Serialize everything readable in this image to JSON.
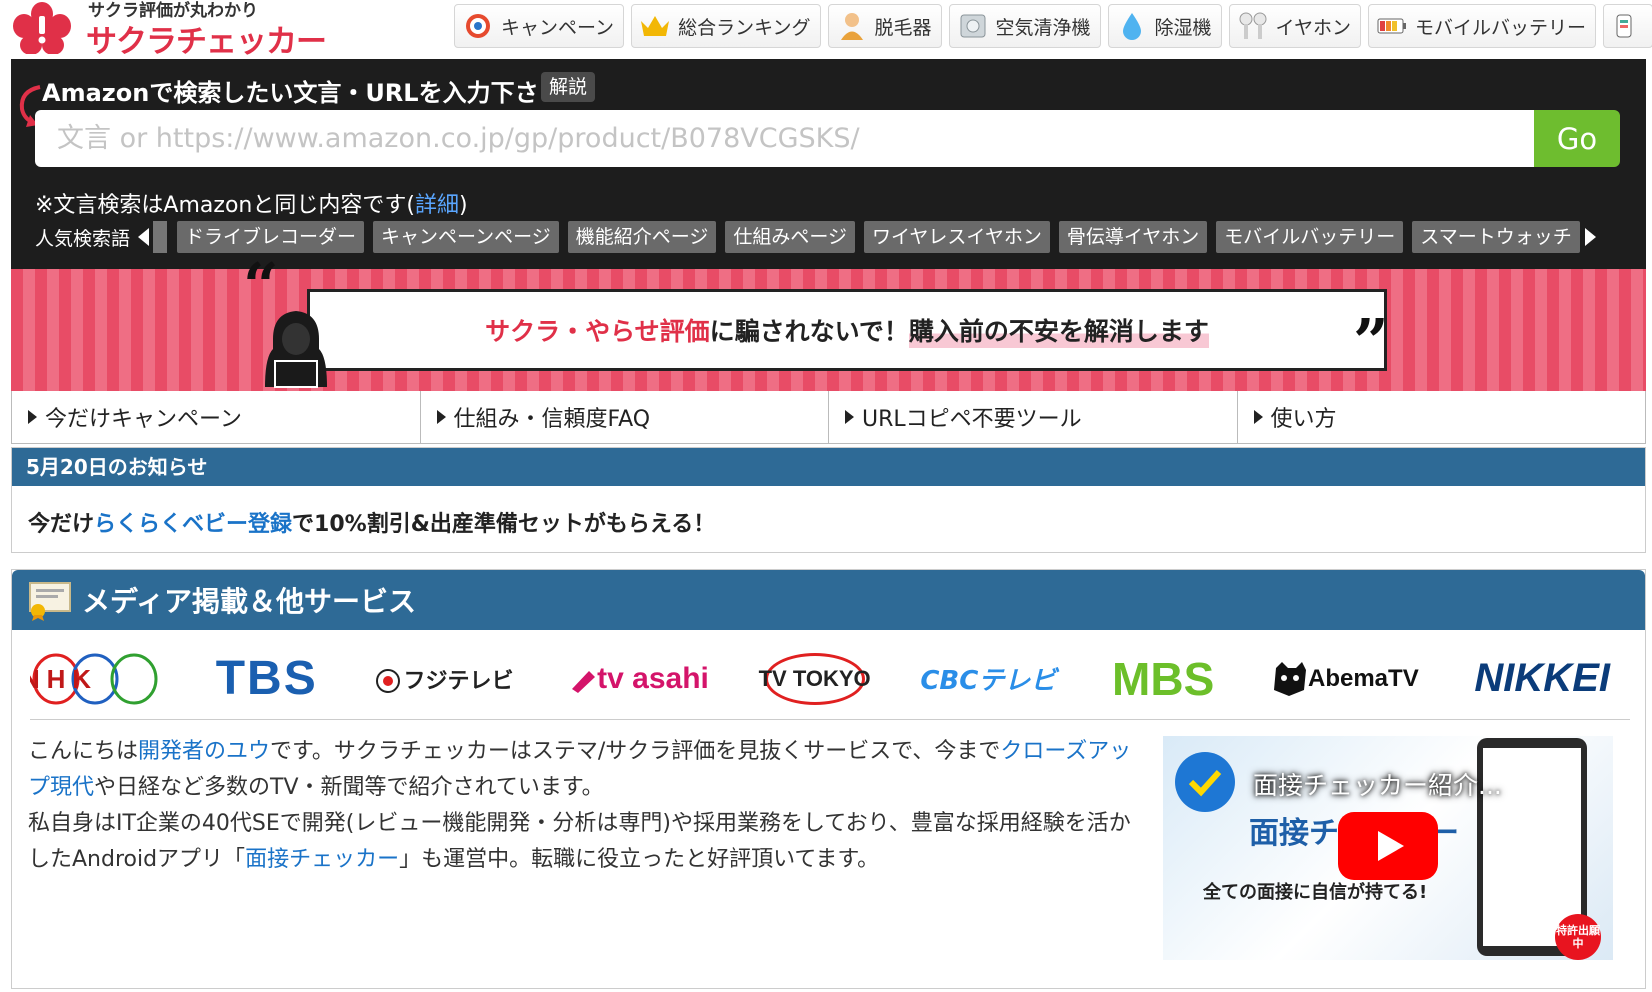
{
  "header": {
    "tagline": "サクラ評価が丸わかり",
    "site_name": "サクラチェッカー",
    "nav": [
      {
        "label": "キャンペーン",
        "icon": "target-icon"
      },
      {
        "label": "総合ランキング",
        "icon": "crown-icon"
      },
      {
        "label": "脱毛器",
        "icon": "person-icon"
      },
      {
        "label": "空気清浄機",
        "icon": "air-purifier-icon"
      },
      {
        "label": "除湿機",
        "icon": "water-drop-icon"
      },
      {
        "label": "イヤホン",
        "icon": "earphones-icon"
      },
      {
        "label": "モバイルバッテリー",
        "icon": "battery-icon"
      }
    ]
  },
  "search": {
    "title": "Amazonで検索したい文言・URLを入力下さい",
    "help_badge": "解説",
    "placeholder": "文言 or https://www.amazon.co.jp/gp/product/B078VCGSKS/",
    "go_label": "Go",
    "note_prefix": "※文言検索はAmazonと同じ内容です(",
    "note_link": "詳細",
    "note_suffix": ")",
    "popular_label": "人気検索語",
    "popular_tags": [
      "ドライブレコーダー",
      "キャンペーンページ",
      "機能紹介ページ",
      "仕組みページ",
      "ワイヤレスイヤホン",
      "骨伝導イヤホン",
      "モバイルバッテリー",
      "スマートウォッチ"
    ]
  },
  "banner": {
    "red_text": "サクラ・やらせ評価",
    "mid_text": "に騙されないで！",
    "hl_text": "購入前の不安を解消します"
  },
  "tabs": [
    "今だけキャンペーン",
    "仕組み・信頼度FAQ",
    "URLコピペ不要ツール",
    "使い方"
  ],
  "notice": {
    "head": "5月20日のお知らせ",
    "prefix": "今だけ",
    "link": "らくらくベビー登録",
    "suffix": "で10%割引&出産準備セットがもらえる！"
  },
  "media": {
    "head": "メディア掲載＆他サービス",
    "logos": [
      "NHK",
      "TBS",
      "フジテレビ",
      "tv asahi",
      "TV TOKYO",
      "CBCテレビ",
      "MBS",
      "AbemaTV",
      "NIKKEI"
    ],
    "intro": {
      "p1": "こんにちは",
      "link1": "開発者のユウ",
      "p2": "です。サクラチェッカーはステマ/サクラ評価を見抜くサービスで、今まで",
      "link2": "クローズアップ現代",
      "p3": "や日経など多数のTV・新聞等で紹介されています。",
      "p4": "私自身はIT企業の40代SEで開発(レビュー機能開発・分析は専門)や採用業務をしており、豊富な採用経験を活かしたAndroidアプリ「",
      "link3": "面接チェッカー",
      "p5": "」も運営中。転職に役立ったと好評頂いてます。"
    },
    "video": {
      "title": "面接チェッカー紹介...",
      "sub": "面接チェッカー",
      "sub2": "全ての面接に自信が持てる!",
      "badge": "特許出願中"
    }
  },
  "colors": {
    "brand_red": "#e03048",
    "go_green": "#6ebd2f",
    "header_blue": "#2e6a96",
    "link_blue": "#1a73c8"
  }
}
